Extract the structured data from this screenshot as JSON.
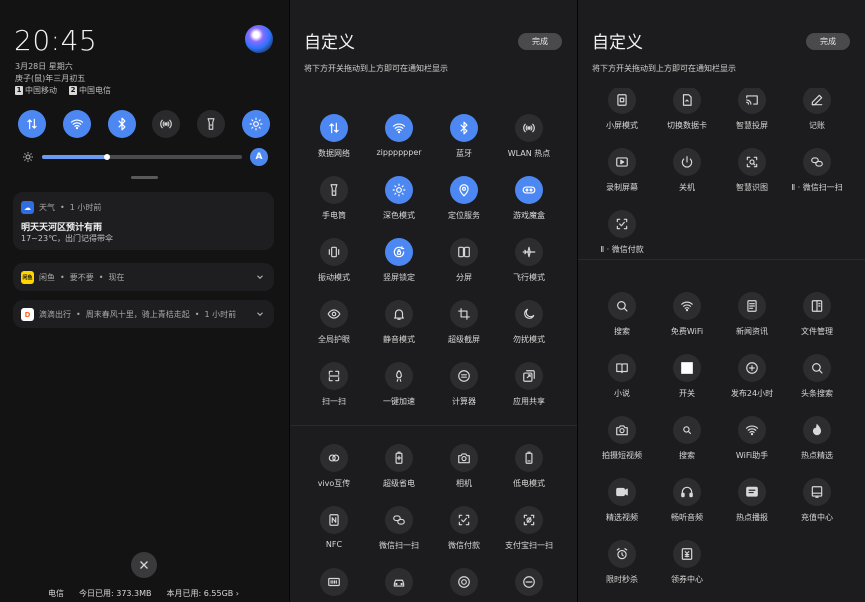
{
  "status": {
    "time": "20:45",
    "date_line1": "3月28日 星期六",
    "date_line2": "庚子(鼠)年三月初五",
    "sims": [
      {
        "num": "1",
        "carrier": "中国移动"
      },
      {
        "num": "2",
        "carrier": "中国电信"
      }
    ]
  },
  "quick_settings": [
    {
      "icon": "data-icon",
      "on": true
    },
    {
      "icon": "wifi-icon",
      "on": true
    },
    {
      "icon": "bluetooth-icon",
      "on": true
    },
    {
      "icon": "hotspot-icon",
      "on": false
    },
    {
      "icon": "flashlight-icon",
      "on": false
    },
    {
      "icon": "dark-mode-icon",
      "on": true
    }
  ],
  "brightness": {
    "level": 0.33,
    "auto_label": "A"
  },
  "notifications": [
    {
      "app": "天气",
      "time": "1 小时前",
      "title": "明天天河区预计有雨",
      "body": "17~23℃，出门记得带伞",
      "color": "#2f6de0",
      "glyph": "☁"
    },
    {
      "app": "闲鱼",
      "text": "要不要",
      "time": "现在",
      "color": "#ffd400",
      "glyph": "闲鱼"
    },
    {
      "app": "滴滴出行",
      "text": "周末春风十里，骑上青桔走起",
      "time": "1 小时前",
      "color": "#ff6a2b",
      "glyph": "D"
    }
  ],
  "usage": {
    "carrier": "电信",
    "today": "今日已用: 373.3MB",
    "month": "本月已用: 6.55GB ›"
  },
  "customize": {
    "title": "自定义",
    "done_label": "完成",
    "subtitle": "将下方开关拖动到上方即可在通知栏显示"
  },
  "panel2_tiles": [
    {
      "label": "数据网络",
      "icon": "data-icon",
      "on": true
    },
    {
      "label": "zipppppper",
      "icon": "wifi-icon",
      "on": true
    },
    {
      "label": "蓝牙",
      "icon": "bluetooth-icon",
      "on": true
    },
    {
      "label": "WLAN 热点",
      "icon": "hotspot-icon",
      "on": false
    },
    {
      "label": "手电筒",
      "icon": "flashlight-icon",
      "on": false
    },
    {
      "label": "深色模式",
      "icon": "dark-mode-icon",
      "on": true
    },
    {
      "label": "定位服务",
      "icon": "location-icon",
      "on": true
    },
    {
      "label": "游戏魔盒",
      "icon": "game-icon",
      "on": true
    },
    {
      "label": "振动模式",
      "icon": "vibrate-icon",
      "on": false
    },
    {
      "label": "竖屏锁定",
      "icon": "rotation-lock-icon",
      "on": true
    },
    {
      "label": "分屏",
      "icon": "split-screen-icon",
      "on": false
    },
    {
      "label": "飞行模式",
      "icon": "airplane-icon",
      "on": false
    },
    {
      "label": "全局护眼",
      "icon": "eye-icon",
      "on": false
    },
    {
      "label": "静音模式",
      "icon": "bell-icon",
      "on": false
    },
    {
      "label": "超级截屏",
      "icon": "screenshot-icon",
      "on": false
    },
    {
      "label": "勿扰模式",
      "icon": "moon-icon",
      "on": false
    },
    {
      "label": "扫一扫",
      "icon": "scan-icon",
      "on": false
    },
    {
      "label": "一键加速",
      "icon": "rocket-icon",
      "on": false
    },
    {
      "label": "计算器",
      "icon": "calculator-icon",
      "on": false
    },
    {
      "label": "应用共享",
      "icon": "app-share-icon",
      "on": false
    },
    {
      "label": "vivo互传",
      "icon": "share-link-icon",
      "on": false
    },
    {
      "label": "超级省电",
      "icon": "battery-plus-icon",
      "on": false
    },
    {
      "label": "相机",
      "icon": "camera-icon",
      "on": false
    },
    {
      "label": "低电模式",
      "icon": "low-battery-icon",
      "on": false
    },
    {
      "label": "NFC",
      "icon": "nfc-icon",
      "on": false
    },
    {
      "label": "微信扫一扫",
      "icon": "wechat-scan-icon",
      "on": false
    },
    {
      "label": "微信付款",
      "icon": "wechat-pay-icon",
      "on": false
    },
    {
      "label": "支付宝扫一扫",
      "icon": "alipay-scan-icon",
      "on": false
    },
    {
      "label": "",
      "icon": "keyboard-icon",
      "on": false
    },
    {
      "label": "",
      "icon": "car-icon",
      "on": false
    },
    {
      "label": "",
      "icon": "record-icon",
      "on": false
    },
    {
      "label": "",
      "icon": "ring-icon",
      "on": false
    }
  ],
  "panel3_tiles": [
    {
      "label": "小屏模式",
      "icon": "small-screen-icon"
    },
    {
      "label": "切换数据卡",
      "icon": "sim-switch-icon"
    },
    {
      "label": "智慧投屏",
      "icon": "cast-icon"
    },
    {
      "label": "记账",
      "icon": "ledger-icon"
    },
    {
      "label": "录制屏幕",
      "icon": "screen-record-icon"
    },
    {
      "label": "关机",
      "icon": "power-icon"
    },
    {
      "label": "智慧识图",
      "icon": "image-recognize-icon"
    },
    {
      "label": "Ⅱ · 微信扫一扫",
      "icon": "wechat-scan-icon"
    },
    {
      "label": "Ⅱ · 微信付款",
      "icon": "wechat-pay-icon"
    },
    {
      "label": "搜索",
      "icon": "search-icon"
    },
    {
      "label": "免费WiFi",
      "icon": "free-wifi-icon"
    },
    {
      "label": "新闻资讯",
      "icon": "news-icon"
    },
    {
      "label": "文件管理",
      "icon": "file-manager-icon"
    },
    {
      "label": "小说",
      "icon": "book-icon"
    },
    {
      "label": "开关",
      "icon": "toggle-square-icon"
    },
    {
      "label": "发布24小时",
      "icon": "clock-plus-icon"
    },
    {
      "label": "头条搜索",
      "icon": "search-icon"
    },
    {
      "label": "拍摄短视频",
      "icon": "camera-icon"
    },
    {
      "label": "搜索",
      "icon": "search-small-icon"
    },
    {
      "label": "WiFi助手",
      "icon": "wifi-icon"
    },
    {
      "label": "热点精选",
      "icon": "flame-icon"
    },
    {
      "label": "精选视频",
      "icon": "video-icon"
    },
    {
      "label": "畅听音频",
      "icon": "headphones-icon"
    },
    {
      "label": "热点播报",
      "icon": "broadcast-icon"
    },
    {
      "label": "充值中心",
      "icon": "recharge-icon"
    },
    {
      "label": "限时秒杀",
      "icon": "alarm-icon"
    },
    {
      "label": "领券中心",
      "icon": "coupon-icon"
    }
  ]
}
